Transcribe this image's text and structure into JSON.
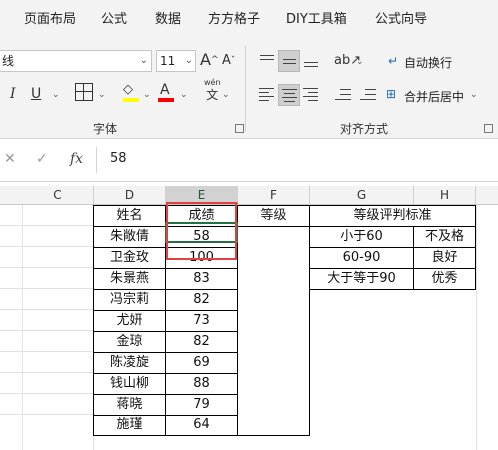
{
  "ribbon_tabs": [
    "页面布局",
    "公式",
    "数据",
    "方方格子",
    "DIY工具箱",
    "公式向导"
  ],
  "ribbon": {
    "font_name_partial": "线",
    "font_size": "11",
    "grow_font": "A",
    "shrink_font": "A",
    "italic": "I",
    "underline": "U",
    "font_color_letter": "A",
    "pinyin_label": "wén",
    "pinyin_char": "文",
    "wrap_text": "自动换行",
    "merge_center": "合并后居中",
    "group_font": "字体",
    "group_alignment": "对齐方式",
    "colors": {
      "highlight": "#ffff00",
      "font_color": "#ff0000",
      "accent": "#217346",
      "annotation": "#e04040"
    }
  },
  "formula_bar": {
    "cancel": "✕",
    "enter": "✓",
    "fx": "fx",
    "value": "58"
  },
  "columns": [
    "C",
    "D",
    "E",
    "F",
    "G",
    "H"
  ],
  "table": {
    "headers": [
      "姓名",
      "成绩",
      "等级"
    ],
    "rows": [
      [
        "朱敞倩",
        "58"
      ],
      [
        "卫金玫",
        "100"
      ],
      [
        "朱景燕",
        "83"
      ],
      [
        "冯宗莉",
        "82"
      ],
      [
        "尤妍",
        "73"
      ],
      [
        "金琼",
        "82"
      ],
      [
        "陈凌旋",
        "69"
      ],
      [
        "钱山柳",
        "88"
      ],
      [
        "蒋晓",
        "79"
      ],
      [
        "施瑾",
        "64"
      ]
    ]
  },
  "criteria": {
    "title": "等级评判标准",
    "rows": [
      [
        "小于60",
        "不及格"
      ],
      [
        "60-90",
        "良好"
      ],
      [
        "大于等于90",
        "优秀"
      ]
    ]
  }
}
